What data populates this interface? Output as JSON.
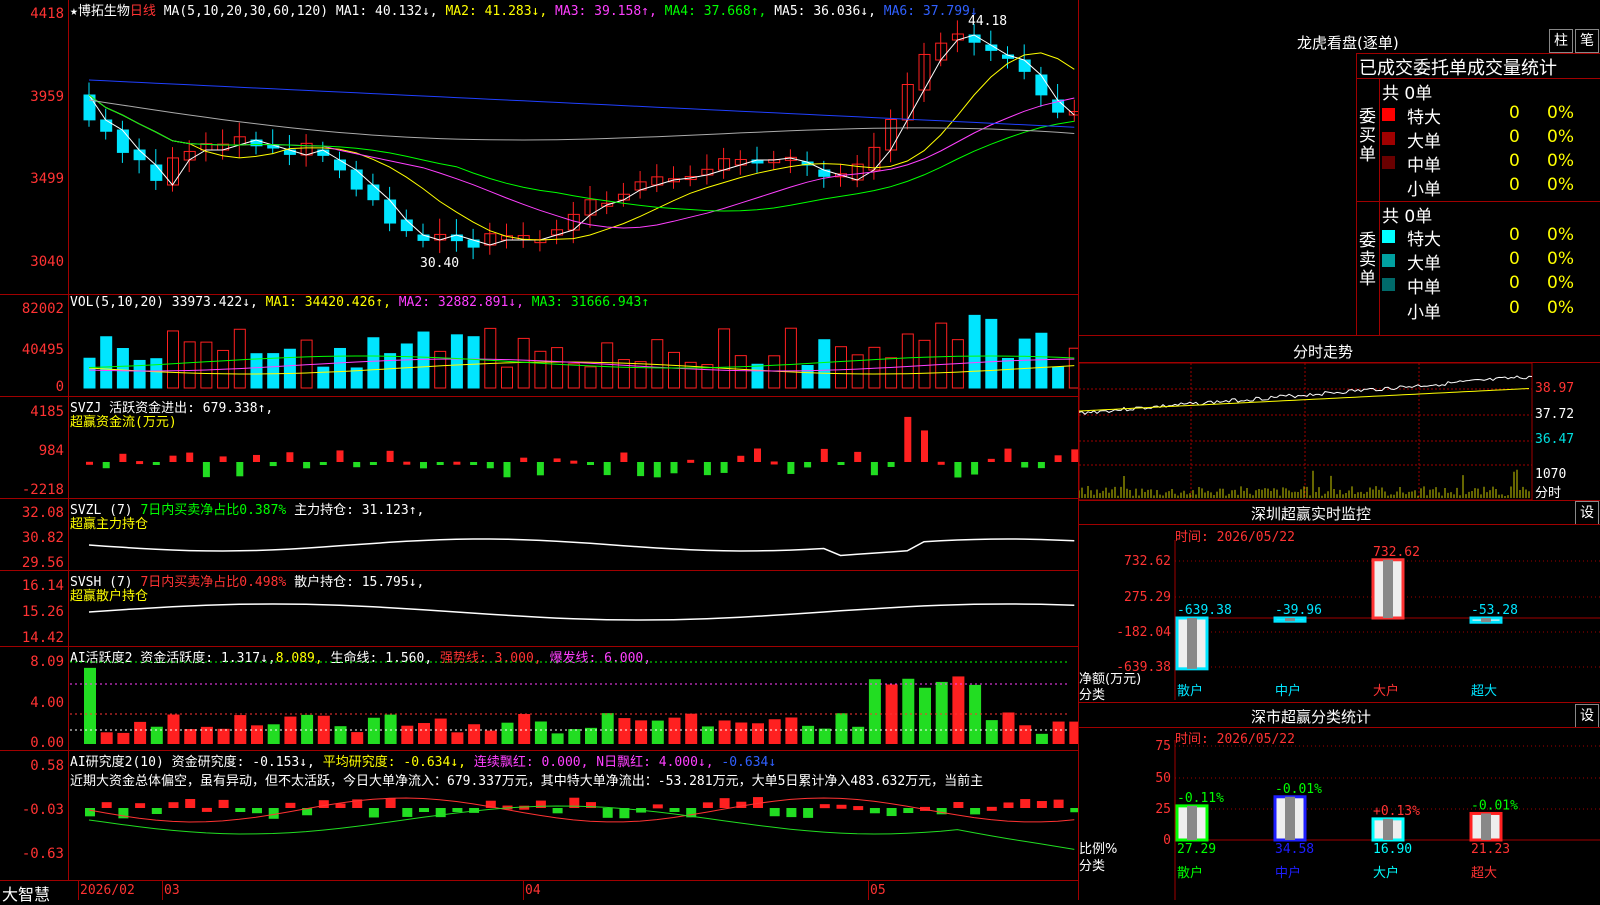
{
  "stock": {
    "name": "博拓生物",
    "period": "日线",
    "star": "★",
    "period_mark": "?"
  },
  "ma_line": {
    "params": "MA(5,10,20,30,60,120)",
    "ma1": "MA1: 40.132↓,",
    "ma2": "MA2: 41.283↓,",
    "ma3": "MA3: 39.158↑,",
    "ma4": "MA4: 37.668↑,",
    "ma5": "MA5: 36.036↓,",
    "ma6": "MA6: 37.799↓"
  },
  "price_axis": [
    "4418",
    "3959",
    "3499",
    "3040"
  ],
  "price_hi": "44.18",
  "price_lo": "30.40",
  "vol": {
    "title": "VOL(5,10,20)",
    "value": "33973.422↓,",
    "ma1": "MA1: 34420.426↑,",
    "ma2": "MA2: 32882.891↓,",
    "ma3": "MA3: 31666.943↑",
    "axis": [
      "82002",
      "40495",
      "0"
    ]
  },
  "svzj": {
    "title": "SVZJ  活跃资金进出: 679.338↑,",
    "sub": "超赢资金流(万元)",
    "axis": [
      "4185",
      "984",
      "-2218"
    ]
  },
  "svzl": {
    "title": "SVZL (7)",
    "t2": "7日内买卖净占比0.387%",
    "t3": "主力持仓: 31.123↑,",
    "sub": "超赢主力持仓",
    "axis": [
      "32.08",
      "30.82",
      "29.56"
    ]
  },
  "svsh": {
    "title": "SVSH (7)",
    "t2": "7日内买卖净占比0.498%",
    "t3": "散户持仓: 15.795↓,",
    "sub": "超赢散户持仓",
    "axis": [
      "16.14",
      "15.26",
      "14.42"
    ]
  },
  "ai_active": {
    "title": "AI活跃度2 资金活跃度: 1.317↓,",
    "v2": "8.089,",
    "v3": "生命线: 1.560,",
    "v4": "强势线: 3.000,",
    "v5": "爆发线: 6.000,",
    "axis": [
      "8.09",
      "4.00",
      "0.00"
    ]
  },
  "ai_research": {
    "title": "AI研究度2(10) 资金研究度: -0.153↓,",
    "v2": "平均研究度: -0.634↓,",
    "v3": "连续飘红: 0.000,",
    "v4": "N日飘红: 4.000↓,",
    "v5": "-0.634↓",
    "axis": [
      "0.58",
      "-0.03",
      "-0.63"
    ],
    "text": "近期大资金总体偏空，虽有异动，但不太活跃，今日大单净流入：679.337万元，其中特大单净流出：-53.281万元，大单5日累计净入483.632万元，当前主"
  },
  "bottom": {
    "brand": "大智慧",
    "date": "2026/02",
    "m1": "03",
    "m2": "04",
    "m3": "05"
  },
  "right": {
    "lhb_title": "龙虎看盘(逐单)",
    "btn_zhu": "柱",
    "btn_bi": "笔",
    "tabs_label": "已成交委托单成交量统计",
    "buy_label": "委买单",
    "sell_label": "委卖单",
    "buy_total": "共 0单",
    "sell_total": "共 0单",
    "buy_rows": [
      {
        "label": "特大",
        "count": "0",
        "pct": "0%",
        "color": "#ff0000"
      },
      {
        "label": "大单",
        "count": "0",
        "pct": "0%",
        "color": "#a00000"
      },
      {
        "label": "中单",
        "count": "0",
        "pct": "0%",
        "color": "#6a0000"
      },
      {
        "label": "小单",
        "count": "0",
        "pct": "0%",
        "color": ""
      }
    ],
    "sell_rows": [
      {
        "label": "特大",
        "count": "0",
        "pct": "0%",
        "color": "#00ffff"
      },
      {
        "label": "大单",
        "count": "0",
        "pct": "0%",
        "color": "#00a0a0"
      },
      {
        "label": "中单",
        "count": "0",
        "pct": "0%",
        "color": "#006a6a"
      },
      {
        "label": "小单",
        "count": "0",
        "pct": "0%",
        "color": ""
      }
    ],
    "fs_title": "分时走势",
    "fs_axis": [
      "38.97",
      "37.72",
      "36.47"
    ],
    "fs_vol": "1070",
    "fs_vol_label": "分时",
    "sz_title": "深圳超赢实时监控",
    "sz_btn": "设",
    "sz_time": "时间: 2026/05/22",
    "sz_axis": [
      "732.62",
      "275.29",
      "-182.04",
      "-639.38"
    ],
    "sz_bars": [
      {
        "cat": "散户",
        "val": -639.38,
        "label": "-639.38"
      },
      {
        "cat": "中户",
        "val": -39.96,
        "label": "-39.96"
      },
      {
        "cat": "大户",
        "val": 732.62,
        "label": "732.62"
      },
      {
        "cat": "超大",
        "val": -53.28,
        "label": "-53.28"
      }
    ],
    "sz_ylabel": "净额(万元)",
    "sz_xlabel": "分类",
    "fl_title": "深市超赢分类统计",
    "fl_btn": "设",
    "fl_time": "时间: 2026/05/22",
    "fl_axis": [
      "75",
      "50",
      "25",
      "0"
    ],
    "fl_bars": [
      {
        "cat": "散户",
        "val": 27.29,
        "label": "27.29",
        "chg": "-0.11%",
        "color": "#00ff00"
      },
      {
        "cat": "中户",
        "val": 34.58,
        "label": "34.58",
        "chg": "-0.01%",
        "color": "#1e1eff"
      },
      {
        "cat": "大户",
        "val": 16.9,
        "label": "16.90",
        "chg": "+0.13%",
        "color": "#00ffff"
      },
      {
        "cat": "超大",
        "val": 21.23,
        "label": "21.23",
        "chg": "-0.01%",
        "color": "#ff2020"
      }
    ],
    "fl_ylabel": "比例%",
    "fl_xlabel": "分类"
  },
  "colors": {
    "up": "#ff2020",
    "down": "#00e5ff",
    "grid": "#a00000"
  }
}
